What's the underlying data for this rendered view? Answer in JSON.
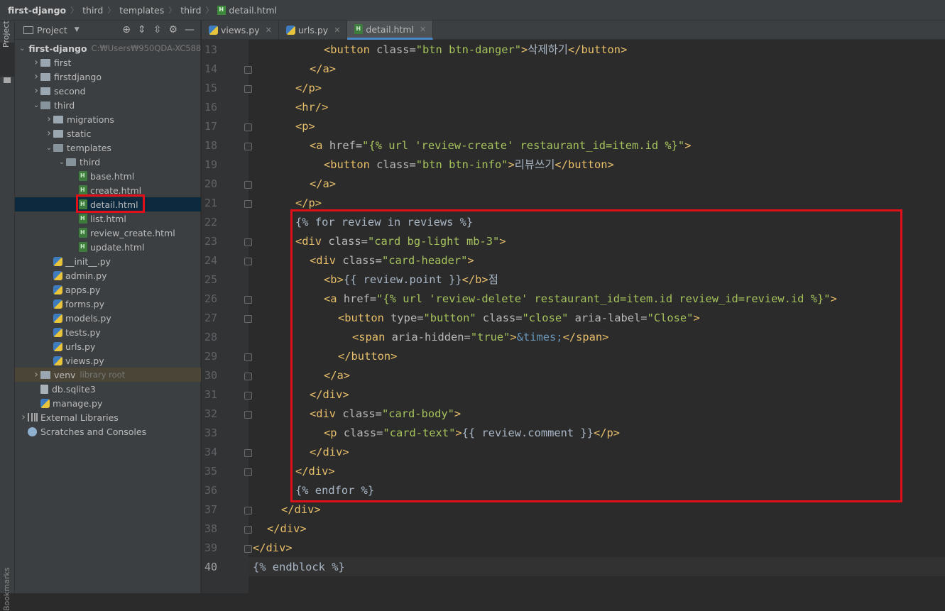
{
  "breadcrumb": [
    "first-django",
    "third",
    "templates",
    "third",
    "detail.html"
  ],
  "left_tool": {
    "project_label": "Project",
    "bookmarks_label": "Bookmarks"
  },
  "project_panel": {
    "title": "Project",
    "tree": [
      {
        "label": "first-django",
        "extra": "C:₩Users₩950QDA-XC588",
        "kind": "folder",
        "depth": 0,
        "expanded": true,
        "bold": true
      },
      {
        "label": "first",
        "kind": "folder",
        "depth": 1,
        "expanded": false
      },
      {
        "label": "firstdjango",
        "kind": "folder",
        "depth": 1,
        "expanded": false
      },
      {
        "label": "second",
        "kind": "folder",
        "depth": 1,
        "expanded": false
      },
      {
        "label": "third",
        "kind": "folder",
        "depth": 1,
        "expanded": true
      },
      {
        "label": "migrations",
        "kind": "folder",
        "depth": 2,
        "expanded": false
      },
      {
        "label": "static",
        "kind": "folder",
        "depth": 2,
        "expanded": false
      },
      {
        "label": "templates",
        "kind": "folder",
        "depth": 2,
        "expanded": true
      },
      {
        "label": "third",
        "kind": "folder",
        "depth": 3,
        "expanded": true
      },
      {
        "label": "base.html",
        "kind": "html",
        "depth": 4
      },
      {
        "label": "create.html",
        "kind": "html",
        "depth": 4
      },
      {
        "label": "detail.html",
        "kind": "html",
        "depth": 4,
        "selected": true
      },
      {
        "label": "list.html",
        "kind": "html",
        "depth": 4
      },
      {
        "label": "review_create.html",
        "kind": "html",
        "depth": 4
      },
      {
        "label": "update.html",
        "kind": "html",
        "depth": 4
      },
      {
        "label": "__init__.py",
        "kind": "py",
        "depth": 2
      },
      {
        "label": "admin.py",
        "kind": "py",
        "depth": 2
      },
      {
        "label": "apps.py",
        "kind": "py",
        "depth": 2
      },
      {
        "label": "forms.py",
        "kind": "py",
        "depth": 2
      },
      {
        "label": "models.py",
        "kind": "py",
        "depth": 2
      },
      {
        "label": "tests.py",
        "kind": "py",
        "depth": 2
      },
      {
        "label": "urls.py",
        "kind": "py",
        "depth": 2
      },
      {
        "label": "views.py",
        "kind": "py",
        "depth": 2
      },
      {
        "label": "venv",
        "extra": "library root",
        "kind": "folder",
        "depth": 1,
        "expanded": false,
        "venv": true
      },
      {
        "label": "db.sqlite3",
        "kind": "db",
        "depth": 1
      },
      {
        "label": "manage.py",
        "kind": "py",
        "depth": 1
      },
      {
        "label": "External Libraries",
        "kind": "lib",
        "depth": 0,
        "expanded": false
      },
      {
        "label": "Scratches and Consoles",
        "kind": "scratch",
        "depth": 0
      }
    ]
  },
  "tabs": [
    {
      "label": "views.py",
      "kind": "py",
      "active": false
    },
    {
      "label": "urls.py",
      "kind": "py",
      "active": false
    },
    {
      "label": "detail.html",
      "kind": "html",
      "active": true
    }
  ],
  "editor": {
    "current_line": 40,
    "lines": [
      {
        "n": "13",
        "indent": 5,
        "fold": false,
        "tokens": [
          [
            "t",
            "<button "
          ],
          [
            "a",
            "class="
          ],
          [
            "s",
            "\"btn btn-danger\""
          ],
          [
            "t",
            ">"
          ],
          [
            "tx",
            "삭제하기"
          ],
          [
            "t",
            "</button>"
          ]
        ]
      },
      {
        "n": "14",
        "indent": 4,
        "fold": true,
        "tokens": [
          [
            "t",
            "</a>"
          ]
        ]
      },
      {
        "n": "15",
        "indent": 3,
        "fold": true,
        "tokens": [
          [
            "t",
            "</p>"
          ]
        ]
      },
      {
        "n": "16",
        "indent": 3,
        "fold": false,
        "tokens": [
          [
            "t",
            "<hr/>"
          ]
        ]
      },
      {
        "n": "17",
        "indent": 3,
        "fold": true,
        "tokens": [
          [
            "t",
            "<p>"
          ]
        ]
      },
      {
        "n": "18",
        "indent": 4,
        "fold": true,
        "tokens": [
          [
            "t",
            "<a "
          ],
          [
            "a",
            "href="
          ],
          [
            "s",
            "\"{% url 'review-create' restaurant_id=item.id %}\""
          ],
          [
            "t",
            ">"
          ]
        ]
      },
      {
        "n": "19",
        "indent": 5,
        "fold": false,
        "tokens": [
          [
            "t",
            "<button "
          ],
          [
            "a",
            "class="
          ],
          [
            "s",
            "\"btn btn-info\""
          ],
          [
            "t",
            ">"
          ],
          [
            "tx",
            "리뷰쓰기"
          ],
          [
            "t",
            "</button>"
          ]
        ]
      },
      {
        "n": "20",
        "indent": 4,
        "fold": true,
        "tokens": [
          [
            "t",
            "</a>"
          ]
        ]
      },
      {
        "n": "21",
        "indent": 3,
        "fold": true,
        "tokens": [
          [
            "t",
            "</p>"
          ]
        ]
      },
      {
        "n": "22",
        "indent": 3,
        "fold": false,
        "tokens": [
          [
            "tpl",
            "{% for review in reviews %}"
          ]
        ]
      },
      {
        "n": "23",
        "indent": 3,
        "fold": true,
        "tokens": [
          [
            "t",
            "<div "
          ],
          [
            "a",
            "class="
          ],
          [
            "s",
            "\"card bg-light mb-3\""
          ],
          [
            "t",
            ">"
          ]
        ]
      },
      {
        "n": "24",
        "indent": 4,
        "fold": true,
        "tokens": [
          [
            "t",
            "<div "
          ],
          [
            "a",
            "class="
          ],
          [
            "s",
            "\"card-header\""
          ],
          [
            "t",
            ">"
          ]
        ]
      },
      {
        "n": "25",
        "indent": 5,
        "fold": false,
        "tokens": [
          [
            "t",
            "<b>"
          ],
          [
            "tpl",
            "{{ review.point }}"
          ],
          [
            "t",
            "</b>"
          ],
          [
            "tx",
            "점"
          ]
        ]
      },
      {
        "n": "26",
        "indent": 5,
        "fold": true,
        "tokens": [
          [
            "t",
            "<a "
          ],
          [
            "a",
            "href="
          ],
          [
            "s",
            "\"{% url 'review-delete' restaurant_id=item.id review_id=review.id %}\""
          ],
          [
            "t",
            ">"
          ]
        ]
      },
      {
        "n": "27",
        "indent": 6,
        "fold": true,
        "tokens": [
          [
            "t",
            "<button "
          ],
          [
            "a",
            "type="
          ],
          [
            "s",
            "\"button\" "
          ],
          [
            "a",
            "class="
          ],
          [
            "s",
            "\"close\" "
          ],
          [
            "a",
            "aria-label="
          ],
          [
            "s",
            "\"Close\""
          ],
          [
            "t",
            ">"
          ]
        ]
      },
      {
        "n": "28",
        "indent": 7,
        "fold": false,
        "tokens": [
          [
            "t",
            "<span "
          ],
          [
            "a",
            "aria-hidden="
          ],
          [
            "s",
            "\"true\""
          ],
          [
            "t",
            ">"
          ],
          [
            "ent",
            "&times;"
          ],
          [
            "t",
            "</span>"
          ]
        ]
      },
      {
        "n": "29",
        "indent": 6,
        "fold": true,
        "tokens": [
          [
            "t",
            "</button>"
          ]
        ]
      },
      {
        "n": "30",
        "indent": 5,
        "fold": true,
        "tokens": [
          [
            "t",
            "</a>"
          ]
        ]
      },
      {
        "n": "31",
        "indent": 4,
        "fold": true,
        "tokens": [
          [
            "t",
            "</div>"
          ]
        ]
      },
      {
        "n": "32",
        "indent": 4,
        "fold": true,
        "tokens": [
          [
            "t",
            "<div "
          ],
          [
            "a",
            "class="
          ],
          [
            "s",
            "\"card-body\""
          ],
          [
            "t",
            ">"
          ]
        ]
      },
      {
        "n": "33",
        "indent": 5,
        "fold": false,
        "tokens": [
          [
            "t",
            "<p "
          ],
          [
            "a",
            "class="
          ],
          [
            "s",
            "\"card-text\""
          ],
          [
            "t",
            ">"
          ],
          [
            "tpl",
            "{{ review.comment }}"
          ],
          [
            "t",
            "</p>"
          ]
        ]
      },
      {
        "n": "34",
        "indent": 4,
        "fold": true,
        "tokens": [
          [
            "t",
            "</div>"
          ]
        ]
      },
      {
        "n": "35",
        "indent": 3,
        "fold": true,
        "tokens": [
          [
            "t",
            "</div>"
          ]
        ]
      },
      {
        "n": "36",
        "indent": 3,
        "fold": false,
        "tokens": [
          [
            "tpl",
            "{% endfor %}"
          ]
        ]
      },
      {
        "n": "37",
        "indent": 2,
        "fold": true,
        "tokens": [
          [
            "t",
            "</div>"
          ]
        ]
      },
      {
        "n": "38",
        "indent": 1,
        "fold": true,
        "tokens": [
          [
            "t",
            "</div>"
          ]
        ]
      },
      {
        "n": "39",
        "indent": 0,
        "fold": true,
        "tokens": [
          [
            "t",
            "</div>"
          ]
        ]
      },
      {
        "n": "40",
        "indent": 0,
        "fold": false,
        "tokens": [
          [
            "tpl",
            "{% endblock %}"
          ]
        ]
      }
    ]
  },
  "colors": {
    "highlight_box": "#e0101a",
    "tag": "#e8bf6a",
    "string": "#a5c25c",
    "attr": "#bababa",
    "text": "#a9b7c6",
    "entity": "#6897bb",
    "selection": "#0d293e"
  }
}
